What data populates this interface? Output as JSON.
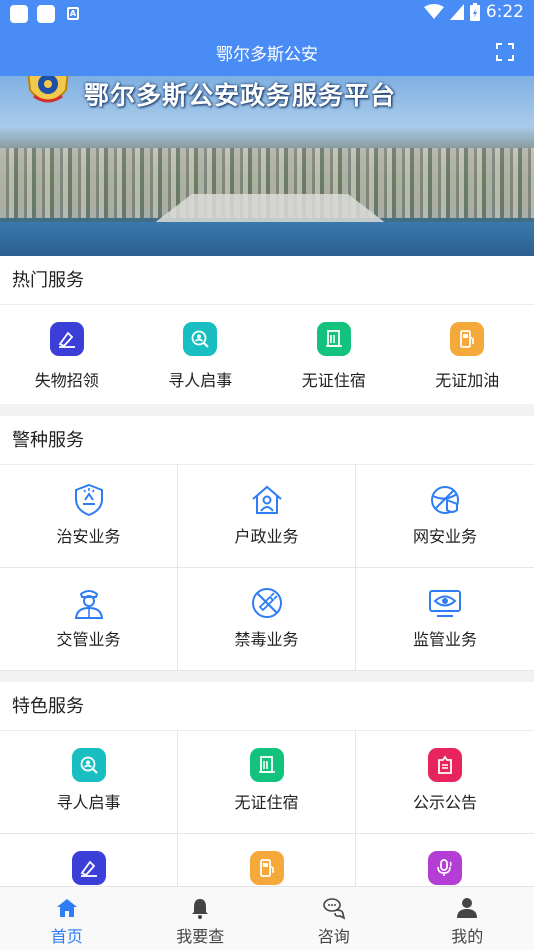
{
  "status_bar": {
    "time": "6:22"
  },
  "header": {
    "title": "鄂尔多斯公安"
  },
  "banner": {
    "heading": "鄂尔多斯公安政务服务平台"
  },
  "hot_services": {
    "title": "热门服务",
    "items": [
      {
        "label": "失物招领",
        "icon": "lost-found-icon",
        "color": "#3b3fd8"
      },
      {
        "label": "寻人启事",
        "icon": "person-search-icon",
        "color": "#19bfc0"
      },
      {
        "label": "无证住宿",
        "icon": "document-icon",
        "color": "#13c27c"
      },
      {
        "label": "无证加油",
        "icon": "fuel-icon",
        "color": "#f6a93b"
      }
    ]
  },
  "police_services": {
    "title": "警种服务",
    "items": [
      {
        "label": "治安业务",
        "icon": "shield-icon"
      },
      {
        "label": "户政业务",
        "icon": "house-person-icon"
      },
      {
        "label": "网安业务",
        "icon": "net-security-icon"
      },
      {
        "label": "交管业务",
        "icon": "traffic-officer-icon"
      },
      {
        "label": "禁毒业务",
        "icon": "no-drugs-icon"
      },
      {
        "label": "监管业务",
        "icon": "monitor-eye-icon"
      }
    ],
    "icon_color": "#2f7df6"
  },
  "special_services": {
    "title": "特色服务",
    "items": [
      {
        "label": "寻人启事",
        "icon": "person-search-icon",
        "color": "#19bfc0"
      },
      {
        "label": "无证住宿",
        "icon": "document-icon",
        "color": "#13c27c"
      },
      {
        "label": "公示公告",
        "icon": "notice-icon",
        "color": "#e8245e"
      },
      {
        "label": "",
        "icon": "lost-found-icon",
        "color": "#3b3fd8"
      },
      {
        "label": "",
        "icon": "fuel-icon",
        "color": "#f6a93b"
      },
      {
        "label": "",
        "icon": "voice-icon",
        "color": "#b43dd6"
      }
    ]
  },
  "bottom_nav": {
    "items": [
      {
        "label": "首页",
        "icon": "home-icon",
        "active": true
      },
      {
        "label": "我要查",
        "icon": "bell-icon",
        "active": false
      },
      {
        "label": "咨询",
        "icon": "chat-icon",
        "active": false
      },
      {
        "label": "我的",
        "icon": "user-icon",
        "active": false
      }
    ],
    "active_color": "#2f7df6"
  }
}
